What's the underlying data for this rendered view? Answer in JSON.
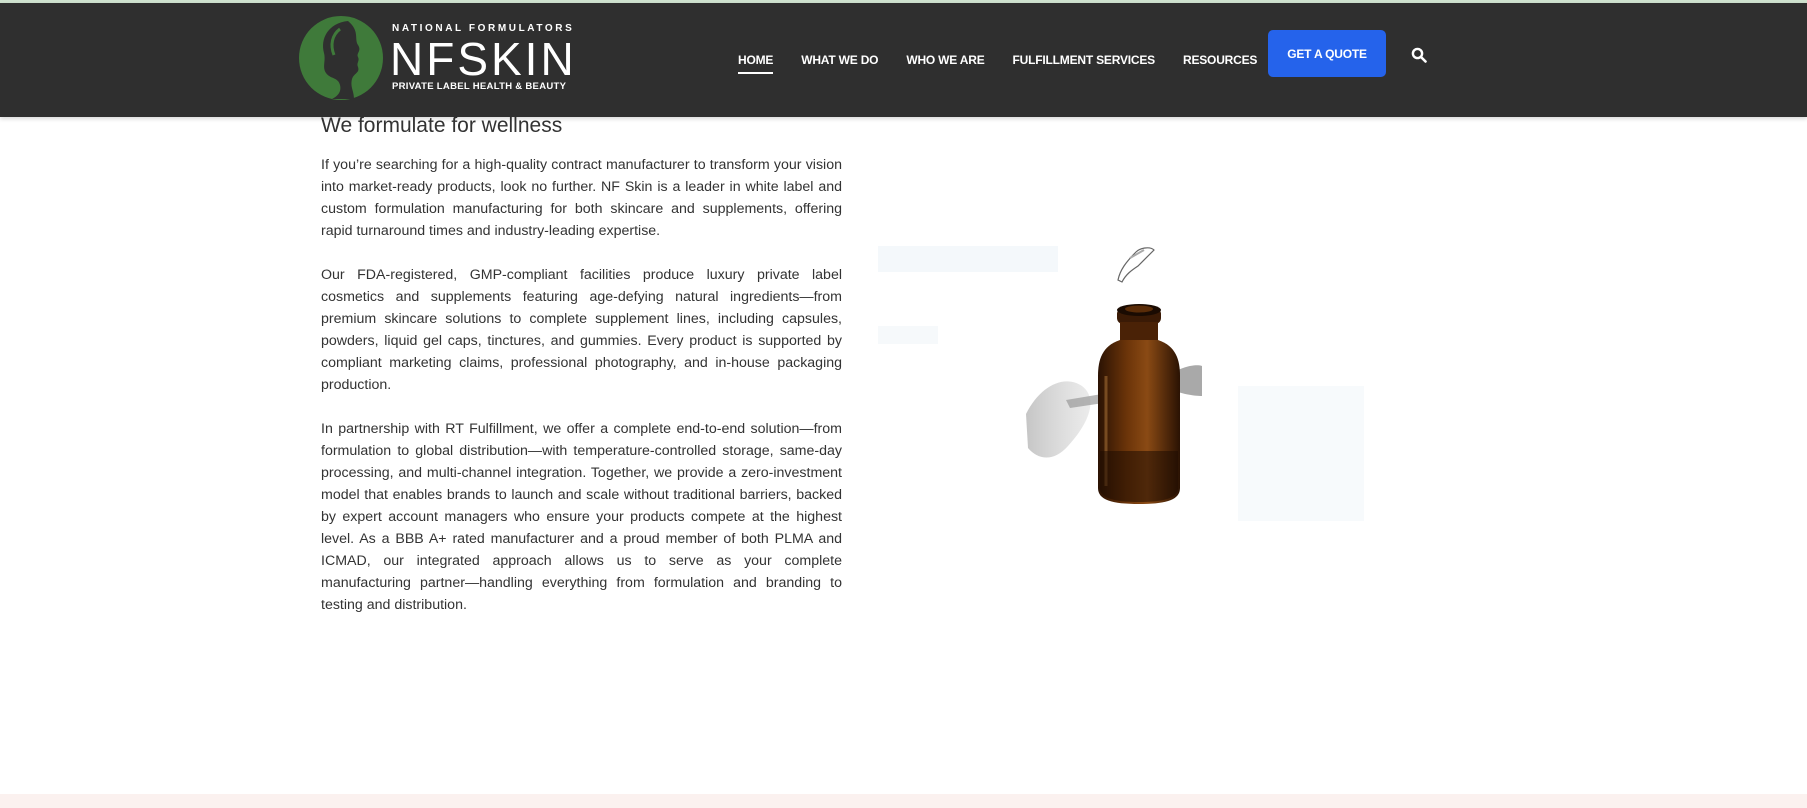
{
  "brand": {
    "top_line": "NATIONAL FORMULATORS",
    "name": "NFSKIN",
    "tagline": "PRIVATE LABEL HEALTH & BEAUTY",
    "colors": {
      "logo_green": "#3f7a3a",
      "header_bg": "#2f2f2f",
      "accent_blue": "#2563eb"
    }
  },
  "nav": {
    "items": [
      {
        "label": "HOME",
        "active": true
      },
      {
        "label": "WHAT WE DO",
        "active": false
      },
      {
        "label": "WHO WE ARE",
        "active": false
      },
      {
        "label": "FULFILLMENT SERVICES",
        "active": false
      },
      {
        "label": "RESOURCES",
        "active": false
      }
    ],
    "cta_label": "GET A QUOTE",
    "search_icon": "search-icon"
  },
  "main": {
    "heading": "We formulate for wellness",
    "paragraphs": [
      "If you’re searching for a high-quality contract manufacturer to transform your vision into market-ready products, look no further. NF Skin is a leader in white label and custom formulation manufacturing for both skincare and supplements, offering rapid turnaround times and industry-leading expertise.",
      "Our FDA-registered, GMP-compliant facilities produce luxury private label cosmetics and supplements featuring age-defying natural ingredients—from premium skincare solutions to complete supplement lines, including capsules, powders, liquid gel caps, tinctures, and gummies. Every product is supported by compliant marketing claims, professional photography, and in-house packaging production.",
      "In partnership with RT Fulfillment, we offer a complete end-to-end solution—from formulation to global distribution—with temperature-controlled storage, same-day processing, and multi-channel integration. Together, we provide a zero-investment model that enables brands to launch and scale without traditional barriers, backed by expert account managers who ensure your products compete at the highest level. As a BBB A+ rated manufacturer and a proud member of both PLMA and ICMAD, our integrated approach allows us to serve as your complete manufacturing partner—handling everything from formulation and branding to testing and distribution."
    ],
    "image": {
      "subject": "amber dropper bottle with glass pipette",
      "bottle_color": "#5a2c08"
    }
  }
}
